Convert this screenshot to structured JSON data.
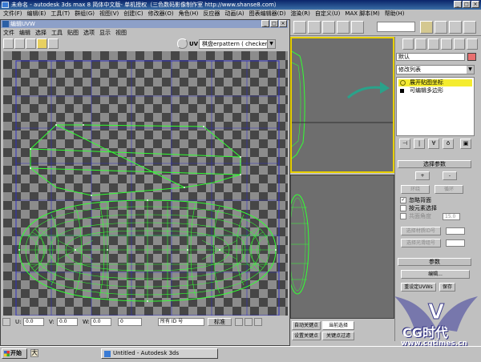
{
  "main_window": {
    "title": "未命名 - autodesk 3ds max 8   简体中文版- 单机授权（三色数码影像制作室   http://www.shanse8.com）",
    "menu": [
      "文件(F)",
      "编辑(E)",
      "工具(T)",
      "群组(G)",
      "视图(V)",
      "创建(C)",
      "修改器(O)",
      "角色(H)",
      "反应器",
      "动画(A)",
      "图表编辑器(D)",
      "渲染(R)",
      "自定义(U)",
      "MAX 脚本(M)",
      "帮助(H)"
    ]
  },
  "uvw_window": {
    "title": "编辑UVW",
    "menu": [
      "文件",
      "编辑",
      "选择",
      "工具",
      "贴图",
      "选项",
      "显示",
      "视图"
    ],
    "uv_label": "UV",
    "checker_dropdown": "棋盘erpattern  ( checker",
    "status": {
      "u_label": "U:",
      "u_value": "0.0",
      "v_label": "V:",
      "v_value": "0.0",
      "w_label": "W:",
      "w_value": "0.0",
      "l_value": "0",
      "id_filter": "所有 ID 号",
      "zoom_label": "标准"
    }
  },
  "command_panel": {
    "object_name": "默认",
    "modifier_list": "修改列表",
    "stack": [
      "展开贴图坐标",
      "可编辑多边形"
    ],
    "selection_rollout": {
      "header": "选择参数",
      "plus": "+",
      "minus": "-",
      "ring": "环绕",
      "loop": "循环",
      "ignore_backface": "忽略背面",
      "select_by_element": "按元素选择",
      "planar_angle": "共面角度",
      "planar_value": "15.0",
      "select_mat_id": "选择材质ID号",
      "select_smooth_group": "选择光滑组号"
    },
    "params_rollout": {
      "header": "参数",
      "edit_button": "编辑...",
      "reset_uvw": "重设定UVWs",
      "save": "保存"
    }
  },
  "anim_bar": {
    "auto_key": "自动关键点",
    "current_selection": "当前选择",
    "set_key": "设置关键点",
    "key_filters": "关键点过滤"
  },
  "taskbar": {
    "start": "开始",
    "task": "Untitled - Autodesk 3ds"
  },
  "watermark": {
    "line1": "CG时代",
    "line2": "www.cgtimes.cn"
  },
  "colors": {
    "uv_wire": "#33ff33",
    "stack_selected": "#f4ec30",
    "viewport_active_border": "#e8d000",
    "annotation_arrow": "#2aa28a"
  }
}
